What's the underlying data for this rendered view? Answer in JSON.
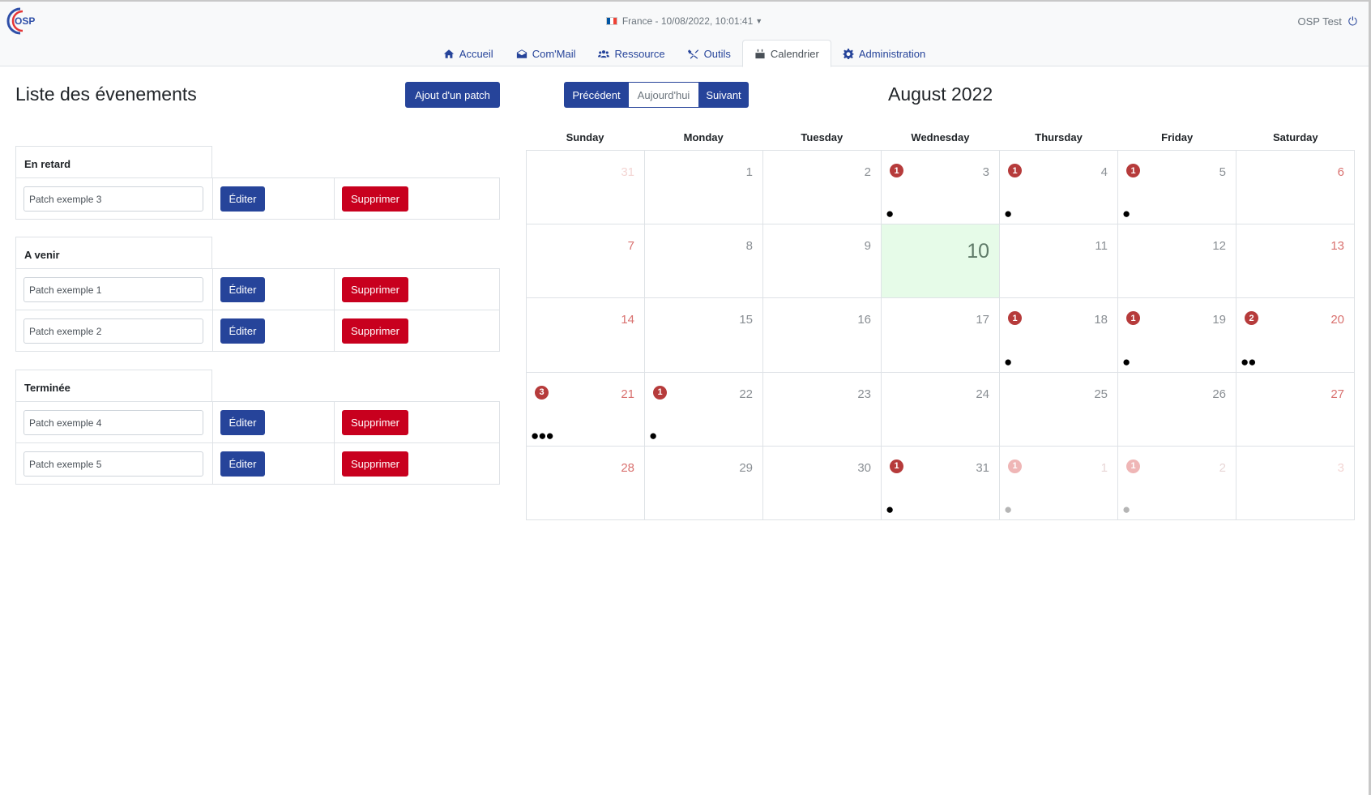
{
  "header": {
    "logo_text": "OSP",
    "locale_text": "France - 10/08/2022, 10:01:41",
    "user_name": "OSP Test"
  },
  "nav": {
    "tabs": [
      {
        "label": "Accueil",
        "icon": "home-icon"
      },
      {
        "label": "Com'Mail",
        "icon": "envelope-icon"
      },
      {
        "label": "Ressource",
        "icon": "users-icon"
      },
      {
        "label": "Outils",
        "icon": "tools-icon"
      },
      {
        "label": "Calendrier",
        "icon": "calendar-icon",
        "active": true
      },
      {
        "label": "Administration",
        "icon": "gear-icon"
      }
    ]
  },
  "events": {
    "title": "Liste des évenements",
    "add_label": "Ajout d'un patch",
    "edit_label": "Éditer",
    "delete_label": "Supprimer",
    "groups": [
      {
        "title": "En retard",
        "items": [
          "Patch exemple 3"
        ]
      },
      {
        "title": "A venir",
        "items": [
          "Patch exemple 1",
          "Patch exemple 2"
        ]
      },
      {
        "title": "Terminée",
        "items": [
          "Patch exemple 4",
          "Patch exemple 5"
        ]
      }
    ]
  },
  "calendar": {
    "prev_label": "Précédent",
    "today_label": "Aujourd'hui",
    "next_label": "Suivant",
    "month_title": "August 2022",
    "weekdays": [
      "Sunday",
      "Monday",
      "Tuesday",
      "Wednesday",
      "Thursday",
      "Friday",
      "Saturday"
    ],
    "days": [
      {
        "day": "31",
        "other": true,
        "count": "",
        "dots": ""
      },
      {
        "day": "1",
        "count": "",
        "dots": ""
      },
      {
        "day": "2",
        "count": "",
        "dots": ""
      },
      {
        "day": "3",
        "count": "1",
        "dots": "●"
      },
      {
        "day": "4",
        "count": "1",
        "dots": "●"
      },
      {
        "day": "5",
        "count": "1",
        "dots": "●"
      },
      {
        "day": "6",
        "count": "",
        "dots": ""
      },
      {
        "day": "7",
        "count": "",
        "dots": ""
      },
      {
        "day": "8",
        "count": "",
        "dots": ""
      },
      {
        "day": "9",
        "count": "",
        "dots": ""
      },
      {
        "day": "10",
        "today": true,
        "count": "",
        "dots": ""
      },
      {
        "day": "11",
        "count": "",
        "dots": ""
      },
      {
        "day": "12",
        "count": "",
        "dots": ""
      },
      {
        "day": "13",
        "count": "",
        "dots": ""
      },
      {
        "day": "14",
        "count": "",
        "dots": ""
      },
      {
        "day": "15",
        "count": "",
        "dots": ""
      },
      {
        "day": "16",
        "count": "",
        "dots": ""
      },
      {
        "day": "17",
        "count": "",
        "dots": ""
      },
      {
        "day": "18",
        "count": "1",
        "dots": "●"
      },
      {
        "day": "19",
        "count": "1",
        "dots": "●"
      },
      {
        "day": "20",
        "count": "2",
        "dots": "●●"
      },
      {
        "day": "21",
        "count": "3",
        "dots": "●●●"
      },
      {
        "day": "22",
        "count": "1",
        "dots": "●"
      },
      {
        "day": "23",
        "count": "",
        "dots": ""
      },
      {
        "day": "24",
        "count": "",
        "dots": ""
      },
      {
        "day": "25",
        "count": "",
        "dots": ""
      },
      {
        "day": "26",
        "count": "",
        "dots": ""
      },
      {
        "day": "27",
        "count": "",
        "dots": ""
      },
      {
        "day": "28",
        "count": "",
        "dots": ""
      },
      {
        "day": "29",
        "count": "",
        "dots": ""
      },
      {
        "day": "30",
        "count": "",
        "dots": ""
      },
      {
        "day": "31",
        "count": "1",
        "dots": "●"
      },
      {
        "day": "1",
        "other": true,
        "count": "1",
        "dots": "●"
      },
      {
        "day": "2",
        "other": true,
        "count": "1",
        "dots": "●"
      },
      {
        "day": "3",
        "other": true,
        "count": "",
        "dots": ""
      }
    ]
  },
  "colors": {
    "primary": "#26449a",
    "danger": "#c8001e",
    "badge": "#b63b3b",
    "today_bg": "#e6fbe8",
    "weekend_text": "#d9716f"
  }
}
